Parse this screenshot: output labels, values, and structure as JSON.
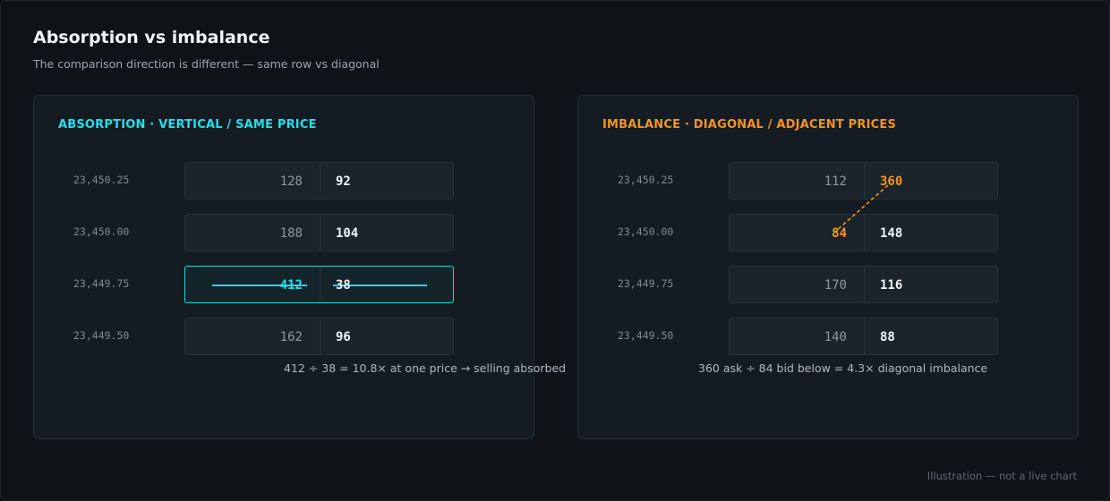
{
  "header": {
    "title": "Absorption vs imbalance",
    "subtitle": "The comparison direction is different — same row vs diagonal"
  },
  "absorption": {
    "heading": "ABSORPTION · VERTICAL / SAME PRICE",
    "rows": [
      {
        "price": "23,450.25",
        "bid": "128",
        "ask": "92"
      },
      {
        "price": "23,450.00",
        "bid": "188",
        "ask": "104"
      },
      {
        "price": "23,449.75",
        "bid": "412",
        "ask": "38"
      },
      {
        "price": "23,449.50",
        "bid": "162",
        "ask": "96"
      }
    ],
    "highlight_row_index": 2,
    "note": "412 ÷ 38 = 10.8× at one price → selling absorbed"
  },
  "imbalance": {
    "heading": "IMBALANCE · DIAGONAL / ADJACENT PRICES",
    "rows": [
      {
        "price": "23,450.25",
        "bid": "112",
        "ask": "360"
      },
      {
        "price": "23,450.00",
        "bid": "84",
        "ask": "148"
      },
      {
        "price": "23,449.75",
        "bid": "170",
        "ask": "116"
      },
      {
        "price": "23,449.50",
        "bid": "140",
        "ask": "88"
      }
    ],
    "diagonal_from": "ask of row 0",
    "diagonal_to": "bid of row 1",
    "note": "360 ask ÷ 84 bid below = 4.3× diagonal imbalance"
  },
  "colors": {
    "absorption_accent": "#22e0ea",
    "imbalance_accent": "#f5941f",
    "background": "#0f1318"
  },
  "footer": "Illustration — not a live chart"
}
